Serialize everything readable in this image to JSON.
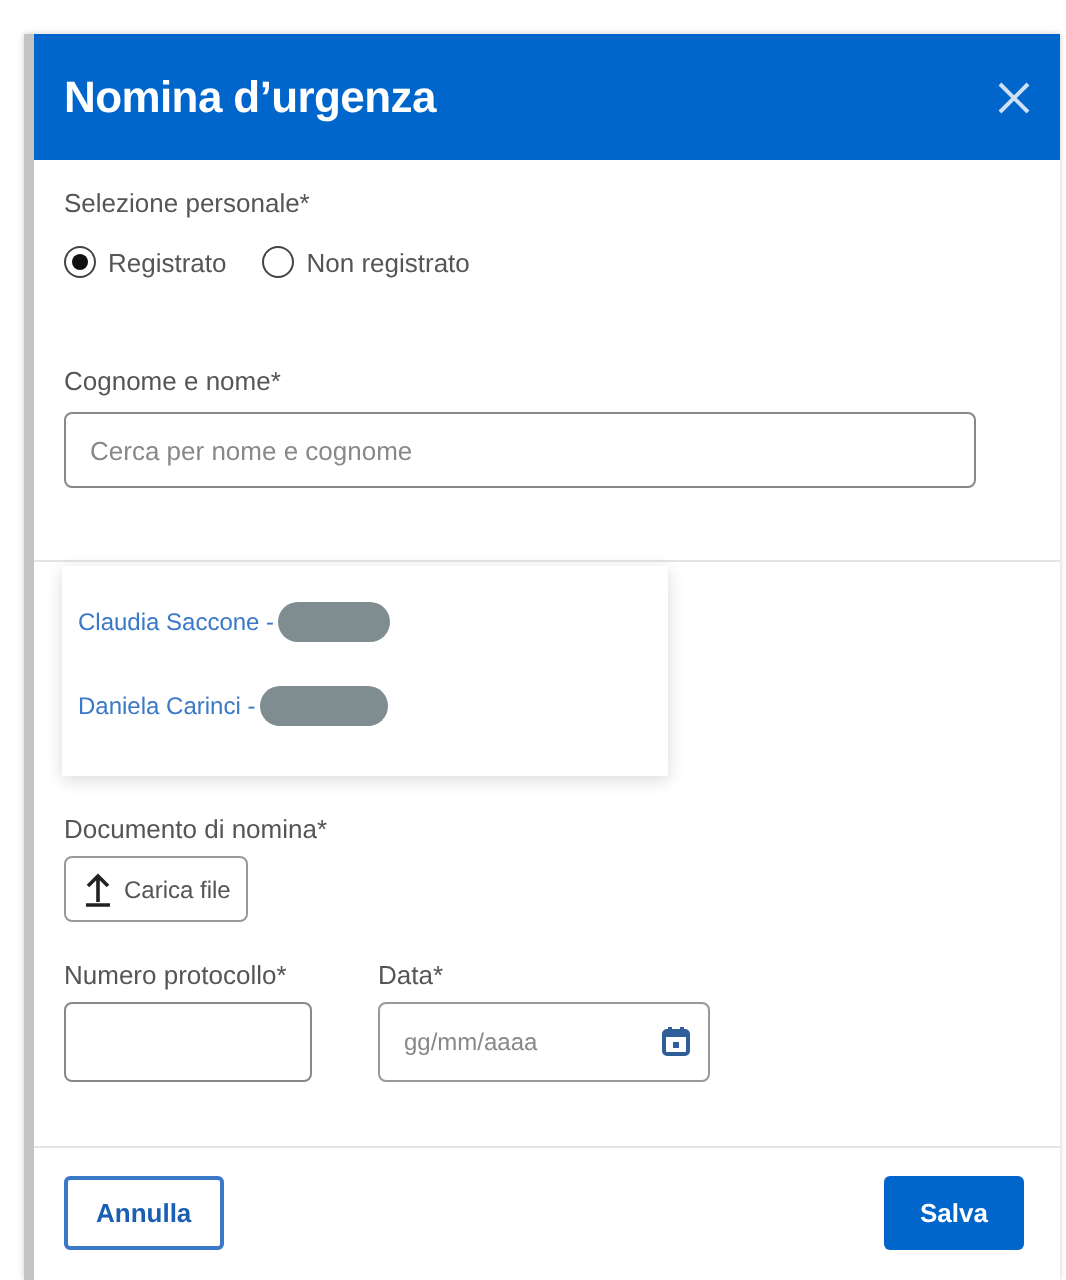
{
  "dialog": {
    "title": "Nomina d’urgenza",
    "selection": {
      "label": "Selezione personale*",
      "options": [
        {
          "label": "Registrato",
          "selected": true
        },
        {
          "label": "Non registrato",
          "selected": false
        }
      ]
    },
    "name_field": {
      "label": "Cognome e nome*",
      "placeholder": "Cerca per nome e cognome"
    },
    "suggestions": [
      {
        "label": "Claudia Saccone -",
        "redacted": true
      },
      {
        "label": "Daniela Carinci -",
        "redacted": true
      }
    ],
    "document": {
      "label": "Documento di nomina*",
      "button": "Carica file"
    },
    "protocol_field": {
      "label": "Numero protocollo*"
    },
    "date_field": {
      "label": "Data*",
      "placeholder": "gg/mm/aaaa"
    },
    "buttons": [
      {
        "label": "Annulla",
        "kind": "secondary"
      },
      {
        "label": "Salva",
        "kind": "primary"
      }
    ]
  }
}
